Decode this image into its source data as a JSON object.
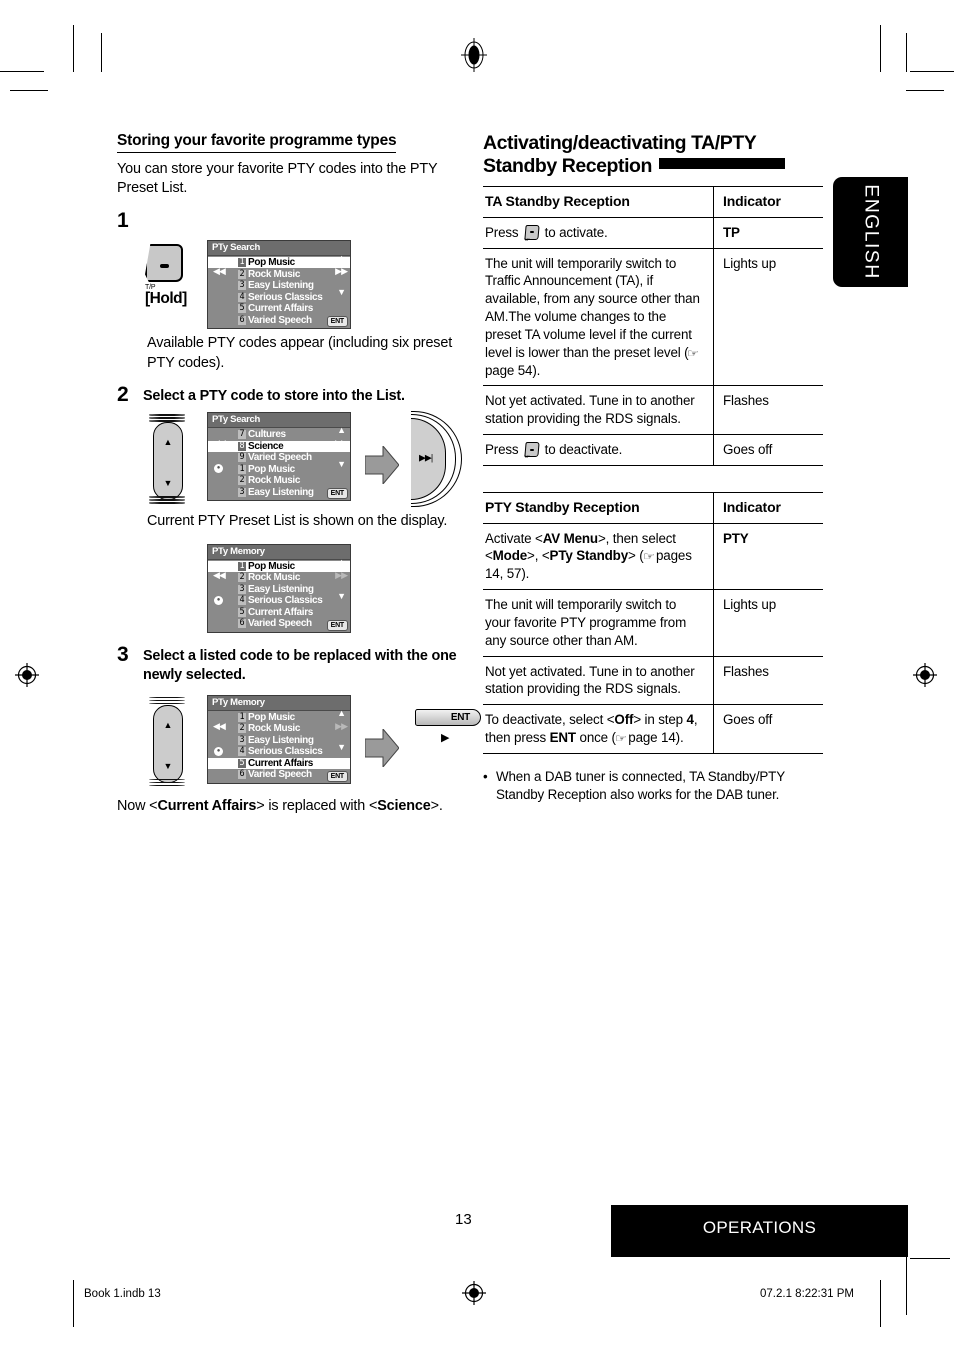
{
  "language_tab": "ENGLISH",
  "left_column": {
    "section_heading": "Storing your favorite programme types",
    "intro": "You can store your favorite PTY codes into the PTY Preset List.",
    "steps": [
      {
        "number": "1",
        "instruction": "",
        "button": {
          "label_top": "T/P",
          "label_bottom": "[Hold]",
          "name": "tp-button"
        },
        "display": {
          "title": "PTy Search",
          "items": [
            {
              "num": "1",
              "label": "Pop Music",
              "selected": true
            },
            {
              "num": "2",
              "label": "Rock Music",
              "selected": false
            },
            {
              "num": "3",
              "label": "Easy Listening",
              "selected": false
            },
            {
              "num": "4",
              "label": "Serious Classics",
              "selected": false
            },
            {
              "num": "5",
              "label": "Current Affairs",
              "selected": false
            },
            {
              "num": "6",
              "label": "Varied Speech",
              "selected": false
            }
          ],
          "ent_badge": "ENT"
        },
        "caption": "Available PTY codes appear (including six preset PTY codes)."
      },
      {
        "number": "2",
        "instruction": "Select a PTY code to store into the List.",
        "display": {
          "title": "PTy Search",
          "items": [
            {
              "num": "7",
              "label": "Cultures",
              "selected": false
            },
            {
              "num": "8",
              "label": "Science",
              "selected": true
            },
            {
              "num": "9",
              "label": "Varied Speech",
              "selected": false
            },
            {
              "num": "1",
              "label": "Pop Music",
              "selected": false
            },
            {
              "num": "2",
              "label": "Rock Music",
              "selected": false
            },
            {
              "num": "3",
              "label": "Easy Listening",
              "selected": false
            }
          ],
          "ent_badge": "ENT"
        },
        "caption": "Current PTY Preset List is shown on the display.",
        "display2": {
          "title": "PTy Memory",
          "items": [
            {
              "num": "1",
              "label": "Pop Music",
              "selected": true
            },
            {
              "num": "2",
              "label": "Rock Music",
              "selected": false
            },
            {
              "num": "3",
              "label": "Easy Listening",
              "selected": false
            },
            {
              "num": "4",
              "label": "Serious Classics",
              "selected": false
            },
            {
              "num": "5",
              "label": "Current Affairs",
              "selected": false
            },
            {
              "num": "6",
              "label": "Varied Speech",
              "selected": false
            }
          ],
          "ent_badge": "ENT"
        }
      },
      {
        "number": "3",
        "instruction": "Select a listed code to be replaced with the one newly selected.",
        "display": {
          "title": "PTy Memory",
          "items": [
            {
              "num": "1",
              "label": "Pop Music",
              "selected": false
            },
            {
              "num": "2",
              "label": "Rock Music",
              "selected": false
            },
            {
              "num": "3",
              "label": "Easy Listening",
              "selected": false
            },
            {
              "num": "4",
              "label": "Serious Classics",
              "selected": false
            },
            {
              "num": "5",
              "label": "Current Affairs",
              "selected": true
            },
            {
              "num": "6",
              "label": "Varied Speech",
              "selected": false
            }
          ],
          "ent_badge": "ENT"
        },
        "ent_button": "ENT",
        "caption_pre": "Now <",
        "caption_bold1": "Current Affairs",
        "caption_mid": "> is replaced with <",
        "caption_bold2": "Science",
        "caption_post": ">."
      }
    ]
  },
  "right_column": {
    "heading_line1": "Activating/deactivating TA/PTY",
    "heading_line2": "Standby Reception",
    "ta_table": {
      "col1_header": "TA Standby Reception",
      "col2_header": "Indicator",
      "rows": [
        {
          "desc_pre": "Press ",
          "has_button": true,
          "desc_post": " to activate.",
          "indicator": "TP",
          "indicator_bold": true
        },
        {
          "desc_pre": "The unit will temporarily switch to Traffic Announcement (TA), if available, from any source other than AM.The volume changes to the preset TA volume level if the current level is lower than the preset level (☞ page 54).",
          "has_button": false,
          "desc_post": "",
          "indicator": "Lights up",
          "indicator_bold": false
        },
        {
          "desc_pre": "Not yet activated. Tune in to another station providing the RDS signals.",
          "has_button": false,
          "desc_post": "",
          "indicator": "Flashes",
          "indicator_bold": false
        },
        {
          "desc_pre": "Press ",
          "has_button": true,
          "desc_post": " to deactivate.",
          "indicator": "Goes off",
          "indicator_bold": false
        }
      ]
    },
    "pty_table": {
      "col1_header": "PTY Standby Reception",
      "col2_header": "Indicator",
      "rows": [
        {
          "html": "Activate &lt;<b>AV Menu</b>&gt;, then select &lt;<b>Mode</b>&gt;, &lt;<b>PTy Standby</b>&gt; (<span class=\"hand\">&#9758;</span> pages 14, 57).",
          "indicator": "PTY",
          "indicator_bold": true
        },
        {
          "html": "The unit will temporarily switch to your favorite PTY programme from any source other than AM.",
          "indicator": "Lights up",
          "indicator_bold": false
        },
        {
          "html": "Not yet activated. Tune in to another station providing the RDS signals.",
          "indicator": "Flashes",
          "indicator_bold": false
        },
        {
          "html": "To deactivate, select &lt;<b>Off</b>&gt; in step <b>4</b>, then press <b>ENT</b> once (<span class=\"hand\">&#9758;</span> page 14).",
          "indicator": "Goes off",
          "indicator_bold": false
        }
      ]
    },
    "note": "When a DAB tuner is connected, TA Standby/PTY Standby Reception also works for the DAB tuner."
  },
  "footer": {
    "page_number": "13",
    "section_banner": "OPERATIONS",
    "file_note": "Book 1.indb   13",
    "timestamp": "07.2.1   8:22:31 PM"
  },
  "colors": {
    "lcd_background": "#8a8a8a",
    "lcd_title_background": "#6d6d6d",
    "banner_background": "#000000",
    "button_face": "#c8c8c8"
  }
}
